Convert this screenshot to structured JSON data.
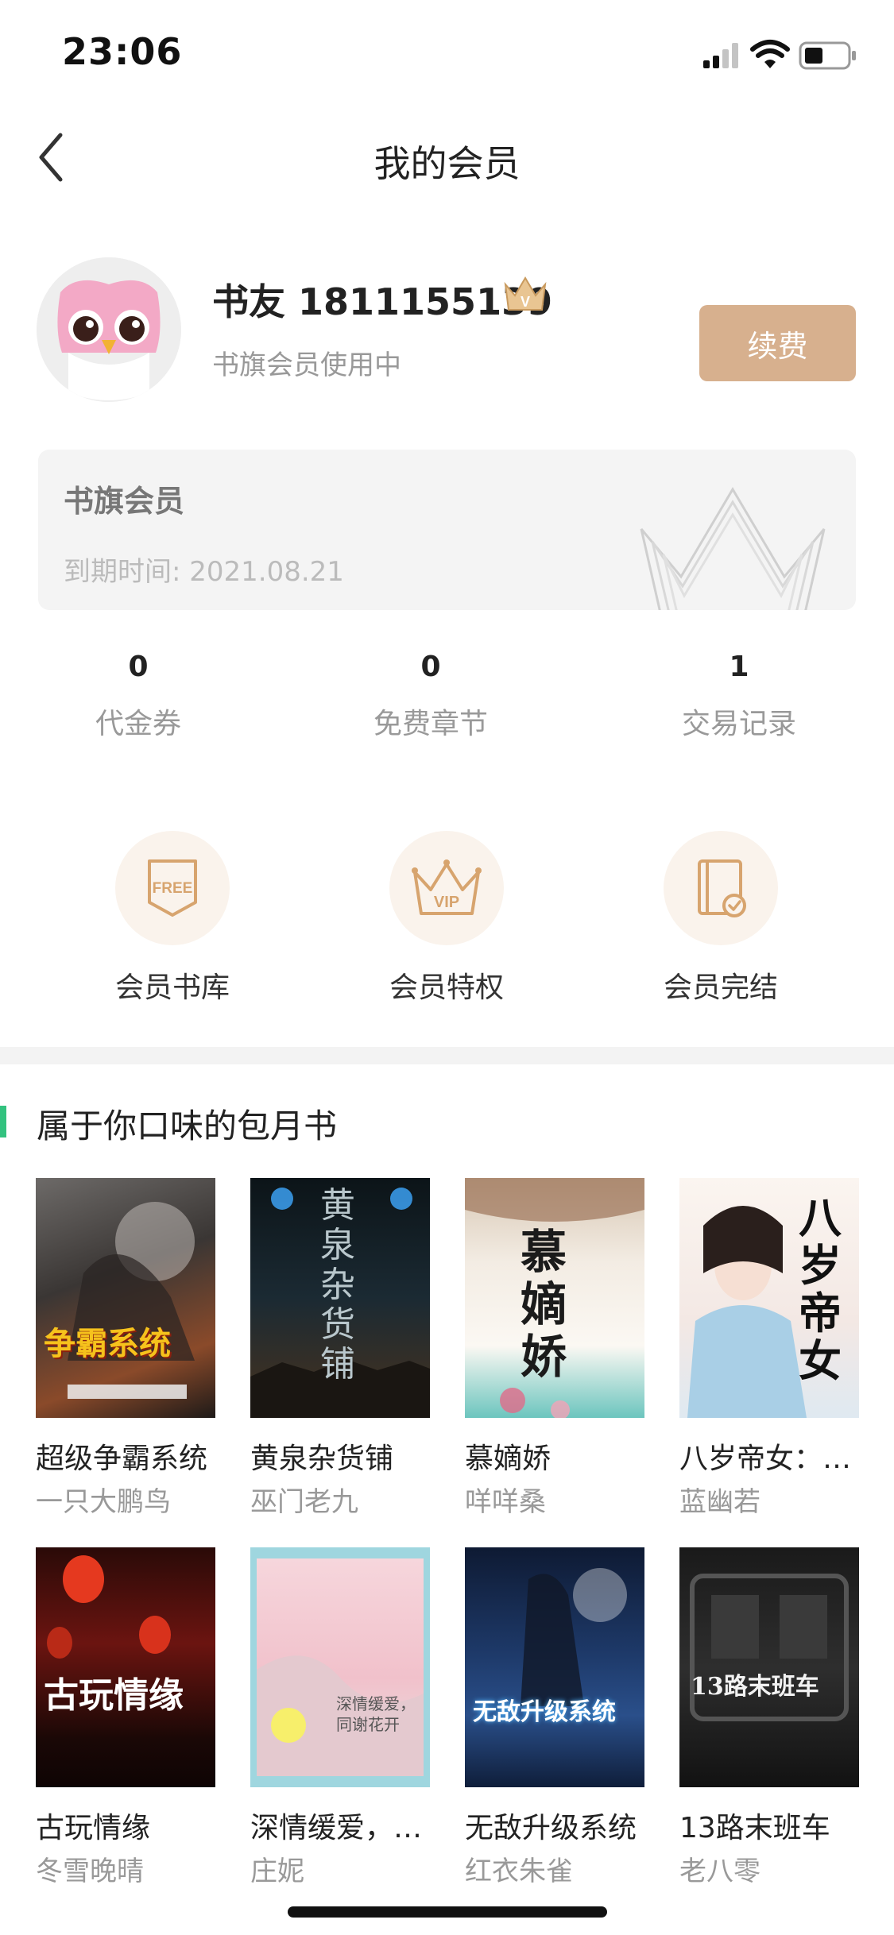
{
  "status_bar": {
    "time": "23:06"
  },
  "nav": {
    "title": "我的会员"
  },
  "profile": {
    "name": "书友 1811155139",
    "status": "书旗会员使用中",
    "renew_label": "续费"
  },
  "member_card": {
    "title": "书旗会员",
    "expiry": "到期时间: 2021.08.21"
  },
  "stats": [
    {
      "value": "0",
      "label": "代金券"
    },
    {
      "value": "0",
      "label": "免费章节"
    },
    {
      "value": "1",
      "label": "交易记录"
    }
  ],
  "features": [
    {
      "label": "会员书库",
      "icon_text": "FREE"
    },
    {
      "label": "会员特权",
      "icon_text": "VIP"
    },
    {
      "label": "会员完结"
    }
  ],
  "section": {
    "title": "属于你口味的包月书"
  },
  "books": [
    {
      "title": "超级争霸系统",
      "author": "一只大鹏鸟",
      "cover_text": "争霸系统"
    },
    {
      "title": "黄泉杂货铺",
      "author": "巫门老九",
      "cover_text": "黄泉杂货铺"
    },
    {
      "title": "慕嫡娇",
      "author": "咩咩桑",
      "cover_text": "慕嫡娇"
    },
    {
      "title": "八岁帝女：…",
      "author": "蓝幽若",
      "cover_text": "八岁帝女"
    },
    {
      "title": "古玩情缘",
      "author": "冬雪晚晴",
      "cover_text": "古玩情缘"
    },
    {
      "title": "深情缓爱，…",
      "author": "庄妮",
      "cover_text": "深情缓爱，同谢花开"
    },
    {
      "title": "无敌升级系统",
      "author": "红衣朱雀",
      "cover_text": "无敌升级系统"
    },
    {
      "title": "13路末班车",
      "author": "老八零",
      "cover_text": "13路末班车"
    }
  ],
  "colors": {
    "accent": "#d7b08e",
    "section_bar": "#33c27f",
    "feature_bg": "#faf3ec",
    "card_bg": "#f4f4f4"
  }
}
